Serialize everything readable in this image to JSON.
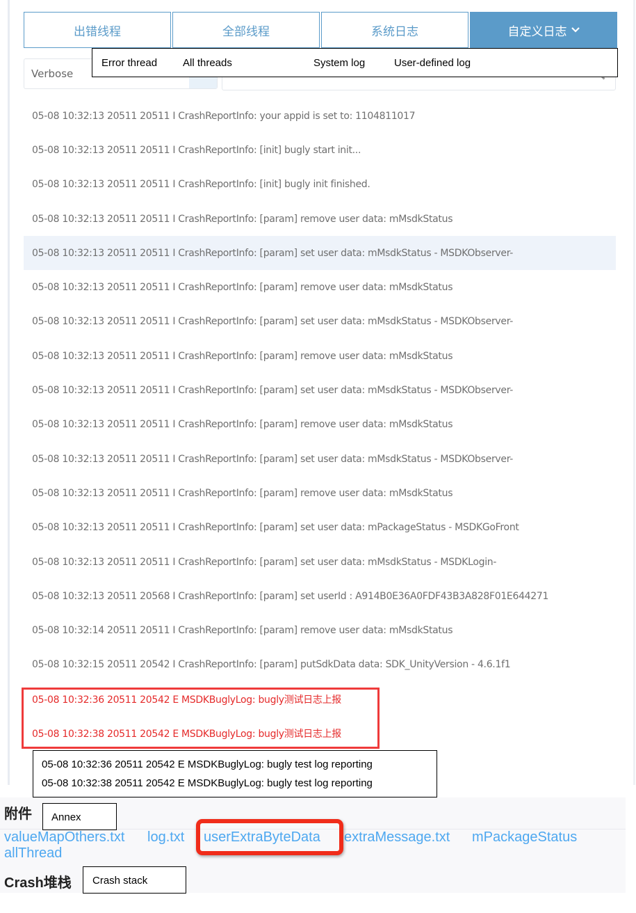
{
  "tabs": [
    {
      "label": "出错线程",
      "active": false
    },
    {
      "label": "全部线程",
      "active": false
    },
    {
      "label": "系统日志",
      "active": false
    },
    {
      "label": "自定义日志",
      "active": true
    }
  ],
  "tab_translations": [
    "Error thread",
    "All threads",
    "System log",
    "User-defined log"
  ],
  "filter": {
    "level": "Verbose",
    "search_placeholder": ""
  },
  "logs": [
    {
      "text": "05-08 10:32:13 20511 20511 I CrashReportInfo: your appid is set to: 1104811017",
      "level": "I"
    },
    {
      "text": "05-08 10:32:13 20511 20511 I CrashReportInfo: [init] bugly start init...",
      "level": "I"
    },
    {
      "text": "05-08 10:32:13 20511 20511 I CrashReportInfo: [init] bugly init finished.",
      "level": "I"
    },
    {
      "text": "05-08 10:32:13 20511 20511 I CrashReportInfo: [param] remove user data: mMsdkStatus",
      "level": "I"
    },
    {
      "text": "05-08 10:32:13 20511 20511 I CrashReportInfo: [param] set user data: mMsdkStatus - MSDKObserver-",
      "level": "I",
      "highlighted": true
    },
    {
      "text": "05-08 10:32:13 20511 20511 I CrashReportInfo: [param] remove user data: mMsdkStatus",
      "level": "I"
    },
    {
      "text": "05-08 10:32:13 20511 20511 I CrashReportInfo: [param] set user data: mMsdkStatus - MSDKObserver-",
      "level": "I"
    },
    {
      "text": "05-08 10:32:13 20511 20511 I CrashReportInfo: [param] remove user data: mMsdkStatus",
      "level": "I"
    },
    {
      "text": "05-08 10:32:13 20511 20511 I CrashReportInfo: [param] set user data: mMsdkStatus - MSDKObserver-",
      "level": "I"
    },
    {
      "text": "05-08 10:32:13 20511 20511 I CrashReportInfo: [param] remove user data: mMsdkStatus",
      "level": "I"
    },
    {
      "text": "05-08 10:32:13 20511 20511 I CrashReportInfo: [param] set user data: mMsdkStatus - MSDKObserver-",
      "level": "I"
    },
    {
      "text": "05-08 10:32:13 20511 20511 I CrashReportInfo: [param] remove user data: mMsdkStatus",
      "level": "I"
    },
    {
      "text": "05-08 10:32:13 20511 20511 I CrashReportInfo: [param] set user data: mPackageStatus - MSDKGoFront",
      "level": "I"
    },
    {
      "text": "05-08 10:32:13 20511 20511 I CrashReportInfo: [param] set user data: mMsdkStatus - MSDKLogin-",
      "level": "I"
    },
    {
      "text": "05-08 10:32:13 20511 20568 I CrashReportInfo: [param] set userId : A914B0E36A0FDF43B3A828F01E644271",
      "level": "I"
    },
    {
      "text": "05-08 10:32:14 20511 20511 I CrashReportInfo: [param] remove user data: mMsdkStatus",
      "level": "I"
    },
    {
      "text": "05-08 10:32:15 20511 20542 I CrashReportInfo: [param] putSdkData data: SDK_UnityVersion - 4.6.1f1",
      "level": "I"
    },
    {
      "text": "05-08 10:32:36 20511 20542 E MSDKBuglyLog: bugly测试日志上报",
      "level": "E"
    },
    {
      "text": "05-08 10:32:38 20511 20542 E MSDKBuglyLog: bugly测试日志上报",
      "level": "E"
    }
  ],
  "error_translations": [
    "05-08 10:32:36  20511  20542 E MSDKBuglyLog: bugly test log reporting",
    "05-08 10:32:38  20511  20542 E MSDKBuglyLog: bugly test log reporting"
  ],
  "attachments": {
    "heading": "附件",
    "heading_translation": "Annex",
    "files": [
      "valueMapOthers.txt",
      "log.txt",
      "userExtraByteData",
      "extraMessage.txt",
      "mPackageStatus",
      "allThread"
    ],
    "highlighted_file": "userExtraByteData"
  },
  "crash_stack": {
    "heading": "Crash堆栈",
    "heading_translation": "Crash stack"
  },
  "colors": {
    "accent": "#5b9bc9",
    "error": "#e52a2a",
    "link": "#4ea8f0",
    "highlight_box": "#f02c1a"
  }
}
